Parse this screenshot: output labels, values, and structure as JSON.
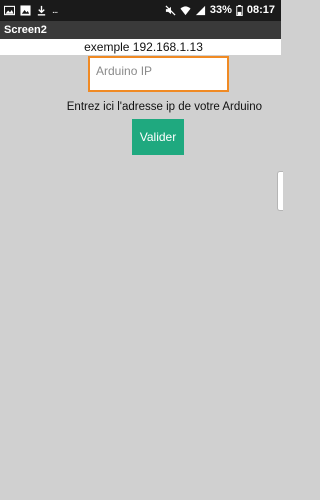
{
  "status_bar": {
    "notification_icons": [
      "image-icon",
      "gallery-icon",
      "download-icon"
    ],
    "overflow_dots": "...",
    "right_icons": [
      "mute-icon",
      "wifi-icon",
      "signal-icon"
    ],
    "battery_percent": "33%",
    "time": "08:17"
  },
  "app": {
    "title": "Screen2"
  },
  "form": {
    "example_text": "exemple 192.168.1.13",
    "ip_placeholder": "Arduino IP",
    "ip_value": "",
    "hint_text": "Entrez ici l'adresse ip de votre Arduino",
    "validate_label": "Valider"
  },
  "colors": {
    "background": "#d0d0d0",
    "input_border": "#f08a24",
    "button": "#1fa97f",
    "status_bar": "#1a1a1a",
    "title_bar": "#3a3a3a"
  }
}
